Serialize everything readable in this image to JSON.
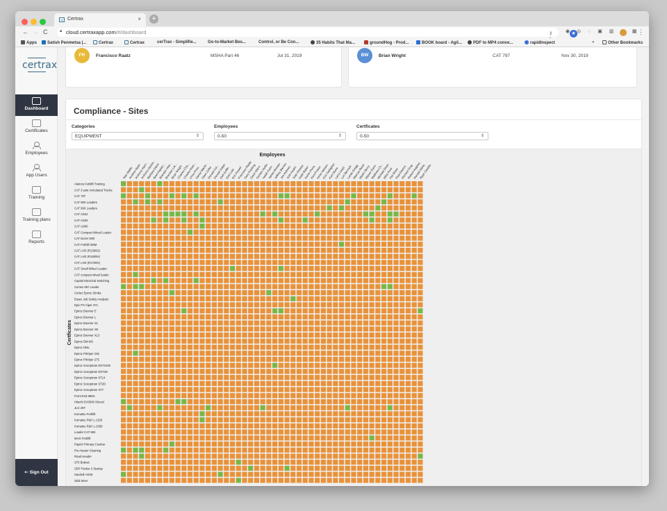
{
  "browser": {
    "tab_title": "Certrax",
    "tab_icon": "ct",
    "url_host": "cloud.certraxapp.com",
    "url_path": "/#/dashboard",
    "bookmarks": [
      "Apps",
      "Satish Penmetsa |...",
      "Certrax",
      "Certrax",
      "cerTrax - Simplifie...",
      "Go-to-Market Bes...",
      "Control, or Be Con...",
      "35 Habits That Ma...",
      "groundHog - Prod...",
      "BOOK board - Agil...",
      "PDF to MP4 conve...",
      "rapidInspect",
      "»",
      "Other Bookmarks"
    ]
  },
  "sidebar": {
    "logo": "certrax",
    "items": [
      {
        "label": "Dashboard",
        "icon": "dashboard-icon",
        "active": true
      },
      {
        "label": "Certificates",
        "icon": "certificate-icon",
        "active": false
      },
      {
        "label": "Employees",
        "icon": "employees-icon",
        "active": false
      },
      {
        "label": "App Users",
        "icon": "app-users-icon",
        "active": false
      },
      {
        "label": "Training",
        "icon": "training-icon",
        "active": false
      },
      {
        "label": "Training plans",
        "icon": "training-plans-icon",
        "active": false
      },
      {
        "label": "Reports",
        "icon": "reports-icon",
        "active": false
      }
    ],
    "sign_out": "⇠ Sign Out"
  },
  "expiring_cards": [
    {
      "initials": "FR",
      "avatar_color": "#e8b93a",
      "name": "Francisco Raatz",
      "certificate": "MSHA Part 46",
      "date": "Jul 31, 2019"
    },
    {
      "initials": "BW",
      "avatar_color": "#5b8fd6",
      "name": "Brian Wright",
      "certificate": "CAT 797",
      "date": "Nov 30, 2019"
    }
  ],
  "compliance": {
    "title": "Compliance - Sites",
    "filters": [
      {
        "label": "Categories",
        "value": "EQUIPMENT"
      },
      {
        "label": "Employees",
        "value": "0-50"
      },
      {
        "label": "Certficates",
        "value": "0-50"
      }
    ],
    "x_title": "Employees",
    "y_title": "Certficates",
    "colors": {
      "compliant": "#7ab648",
      "non_compliant": "#e8923a"
    },
    "employees": [
      "Alan Battle",
      "Andrew Nash",
      "Anthony Harri...",
      "Anthony Opsim...",
      "Barbara Davis",
      "Brad Kaplan...",
      "Brandon Hop...",
      "Brandon Litt...",
      "Brian Wright",
      "Charles Cha...",
      "Charles Davi...",
      "Chris Price",
      "Daniel Martin",
      "Dave Zoller",
      "Donald Col...",
      "Donald Galan",
      "Dott Griffin",
      "Emil Lutz",
      "Eric Powell",
      "Francisco Raatz",
      "Gary Fielding",
      "Gavin Mann",
      "Gordon Hollis",
      "Isaiah Kuhn",
      "James Brooks",
      "Jeffrey Barnes",
      "Jim Holmes",
      "Josh Austin",
      "Juan Alvarez",
      "Katie Baker",
      "Kelvin Pena",
      "Kent Fraser",
      "Kevin Nelson",
      "Kim Gallagher",
      "Kurt Stone",
      "Larry Lloyd",
      "Lori Bennett",
      "Lucas Gregg",
      "Marcus Reed",
      "Martin Berry",
      "Mason Dunn",
      "Matthew Ch...",
      "Michael Dean",
      "Mike Ford",
      "Pat Shaw",
      "Paul Owens",
      "Richard Gray",
      "Robert Hughes",
      "Ronald Wells",
      "Ryan Castillo"
    ],
    "certificates": [
      "Alamos Forklift Training",
      "CAT 3 axle Articulated Trucks",
      "CAT 797",
      "CAT 98X Loaders",
      "CAT 99X Loaders",
      "CAT AD22",
      "CAT AD30",
      "CAT AD60",
      "CAT Compact Wheel Loader",
      "CAT Dozer D60",
      "CAT Forklift 3MM",
      "CAT LHD (R1300G)",
      "CAT LHD (R1600H)",
      "CAT LHD (R1700G)",
      "CAT Small Wheel Loader",
      "CAT compact wheel loader",
      "Capitol Electrical Switching",
      "Cemex 997 Loader",
      "Cortez Epiroc Simba",
      "Essex Job Safety Analysis",
      "Epic PX Viper 371",
      "Epiroc Boomer E",
      "Epiroc Boomer L",
      "Epiroc Boomer S1",
      "Epiroc Boomer XE",
      "Epiroc Boomer XL3",
      "Epiroc DM-M3",
      "Epiroc DML",
      "Epiroc PitViper 235",
      "Epiroc PitViper 275",
      "Epiroc Scooptram EST1030",
      "Epiroc Scooptram EST2D",
      "Epiroc Scooptram ST14",
      "Epiroc Scooptram ST2D",
      "Epiroc Scooptram ST7",
      "Front End 980G",
      "Hitachi EX3600 Shovel",
      "JLG 25T",
      "Komatsu Forklift",
      "Komatsu P&H L-1150",
      "Komatsu P&H L-2350",
      "Loader CAT 993",
      "MAG Forklift",
      "Papich Primary Crusher",
      "Pre-Heater Cleaning",
      "Road Header",
      "S70 Bobcat",
      "SDP Packer 2 Startup",
      "Sandvik AD45",
      "Skid Steer"
    ],
    "compliant_cells": [
      [
        0,
        0
      ],
      [
        0,
        6
      ],
      [
        1,
        3
      ],
      [
        2,
        0
      ],
      [
        2,
        4
      ],
      [
        2,
        8
      ],
      [
        2,
        10
      ],
      [
        2,
        12
      ],
      [
        2,
        26
      ],
      [
        2,
        27
      ],
      [
        2,
        38
      ],
      [
        2,
        44
      ],
      [
        2,
        48
      ],
      [
        3,
        2
      ],
      [
        3,
        4
      ],
      [
        3,
        6
      ],
      [
        3,
        16
      ],
      [
        3,
        37
      ],
      [
        3,
        43
      ],
      [
        4,
        34
      ],
      [
        4,
        36
      ],
      [
        4,
        42
      ],
      [
        5,
        7
      ],
      [
        5,
        8
      ],
      [
        5,
        9
      ],
      [
        5,
        10
      ],
      [
        5,
        12
      ],
      [
        5,
        23
      ],
      [
        5,
        25
      ],
      [
        5,
        32
      ],
      [
        5,
        40
      ],
      [
        5,
        41
      ],
      [
        5,
        44
      ],
      [
        5,
        45
      ],
      [
        6,
        5
      ],
      [
        6,
        7
      ],
      [
        6,
        10
      ],
      [
        6,
        13
      ],
      [
        6,
        26
      ],
      [
        6,
        30
      ],
      [
        6,
        41
      ],
      [
        6,
        44
      ],
      [
        7,
        13
      ],
      [
        8,
        11
      ],
      [
        10,
        36
      ],
      [
        14,
        18
      ],
      [
        14,
        26
      ],
      [
        15,
        2
      ],
      [
        16,
        5
      ],
      [
        16,
        7
      ],
      [
        16,
        12
      ],
      [
        17,
        0
      ],
      [
        17,
        2
      ],
      [
        17,
        3
      ],
      [
        17,
        43
      ],
      [
        17,
        44
      ],
      [
        18,
        8
      ],
      [
        18,
        24
      ],
      [
        19,
        28
      ],
      [
        21,
        10
      ],
      [
        21,
        25
      ],
      [
        21,
        26
      ],
      [
        21,
        49
      ],
      [
        28,
        2
      ],
      [
        30,
        25
      ],
      [
        36,
        0
      ],
      [
        36,
        9
      ],
      [
        36,
        10
      ],
      [
        37,
        1
      ],
      [
        37,
        6
      ],
      [
        37,
        14
      ],
      [
        37,
        23
      ],
      [
        37,
        37
      ],
      [
        37,
        44
      ],
      [
        38,
        13
      ],
      [
        39,
        13
      ],
      [
        42,
        41
      ],
      [
        43,
        8
      ],
      [
        44,
        0
      ],
      [
        44,
        2
      ],
      [
        44,
        3
      ],
      [
        44,
        7
      ],
      [
        45,
        3
      ],
      [
        45,
        49
      ],
      [
        46,
        19
      ],
      [
        47,
        21
      ],
      [
        47,
        27
      ],
      [
        48,
        0
      ],
      [
        48,
        16
      ],
      [
        49,
        19
      ]
    ]
  }
}
